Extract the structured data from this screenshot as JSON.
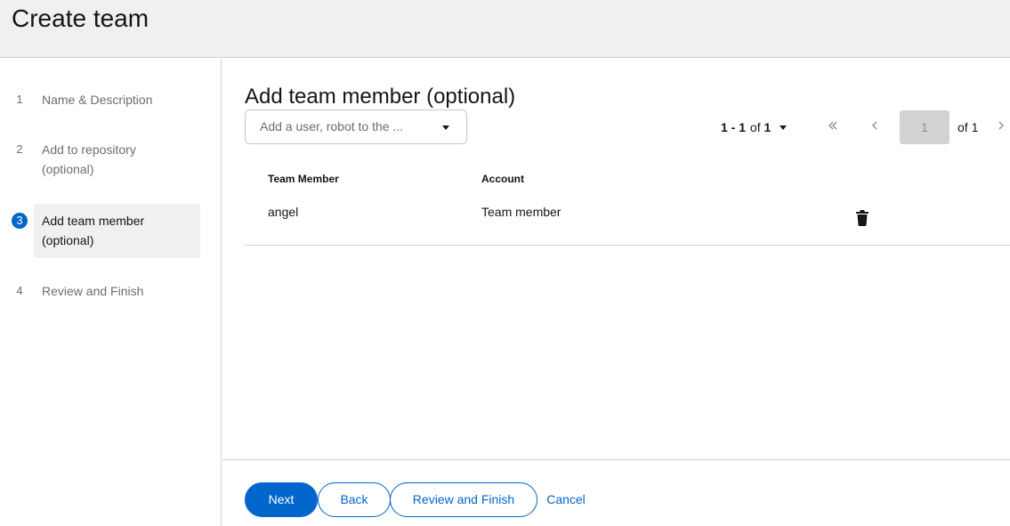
{
  "header": {
    "title": "Create team"
  },
  "wizard": {
    "steps": [
      {
        "num": "1",
        "label": "Name & Description"
      },
      {
        "num": "2",
        "label": "Add to repository (optional)"
      },
      {
        "num": "3",
        "label": "Add team member (optional)"
      },
      {
        "num": "4",
        "label": "Review and Finish"
      }
    ],
    "current_step": 3
  },
  "main": {
    "title": "Add team member (optional)",
    "member_select": {
      "placeholder": "Add a user, robot to the ..."
    },
    "pagination": {
      "range": "1 - 1",
      "of_label": "of",
      "total": "1",
      "current_page": "1",
      "page_of": "of 1",
      "first_icon": "double-chevron-left-icon",
      "prev_icon": "chevron-left-icon",
      "next_icon": "chevron-right-icon"
    },
    "table": {
      "columns": [
        "Team Member",
        "Account"
      ],
      "rows": [
        {
          "member": "angel",
          "account": "Team member",
          "action_icon": "trash-icon"
        }
      ]
    }
  },
  "footer": {
    "next": "Next",
    "back": "Back",
    "review": "Review and Finish",
    "cancel": "Cancel"
  },
  "colors": {
    "accent": "#0066cc",
    "header_bg": "#f0f0f0",
    "active_step_bg": "#f0f0f0"
  }
}
